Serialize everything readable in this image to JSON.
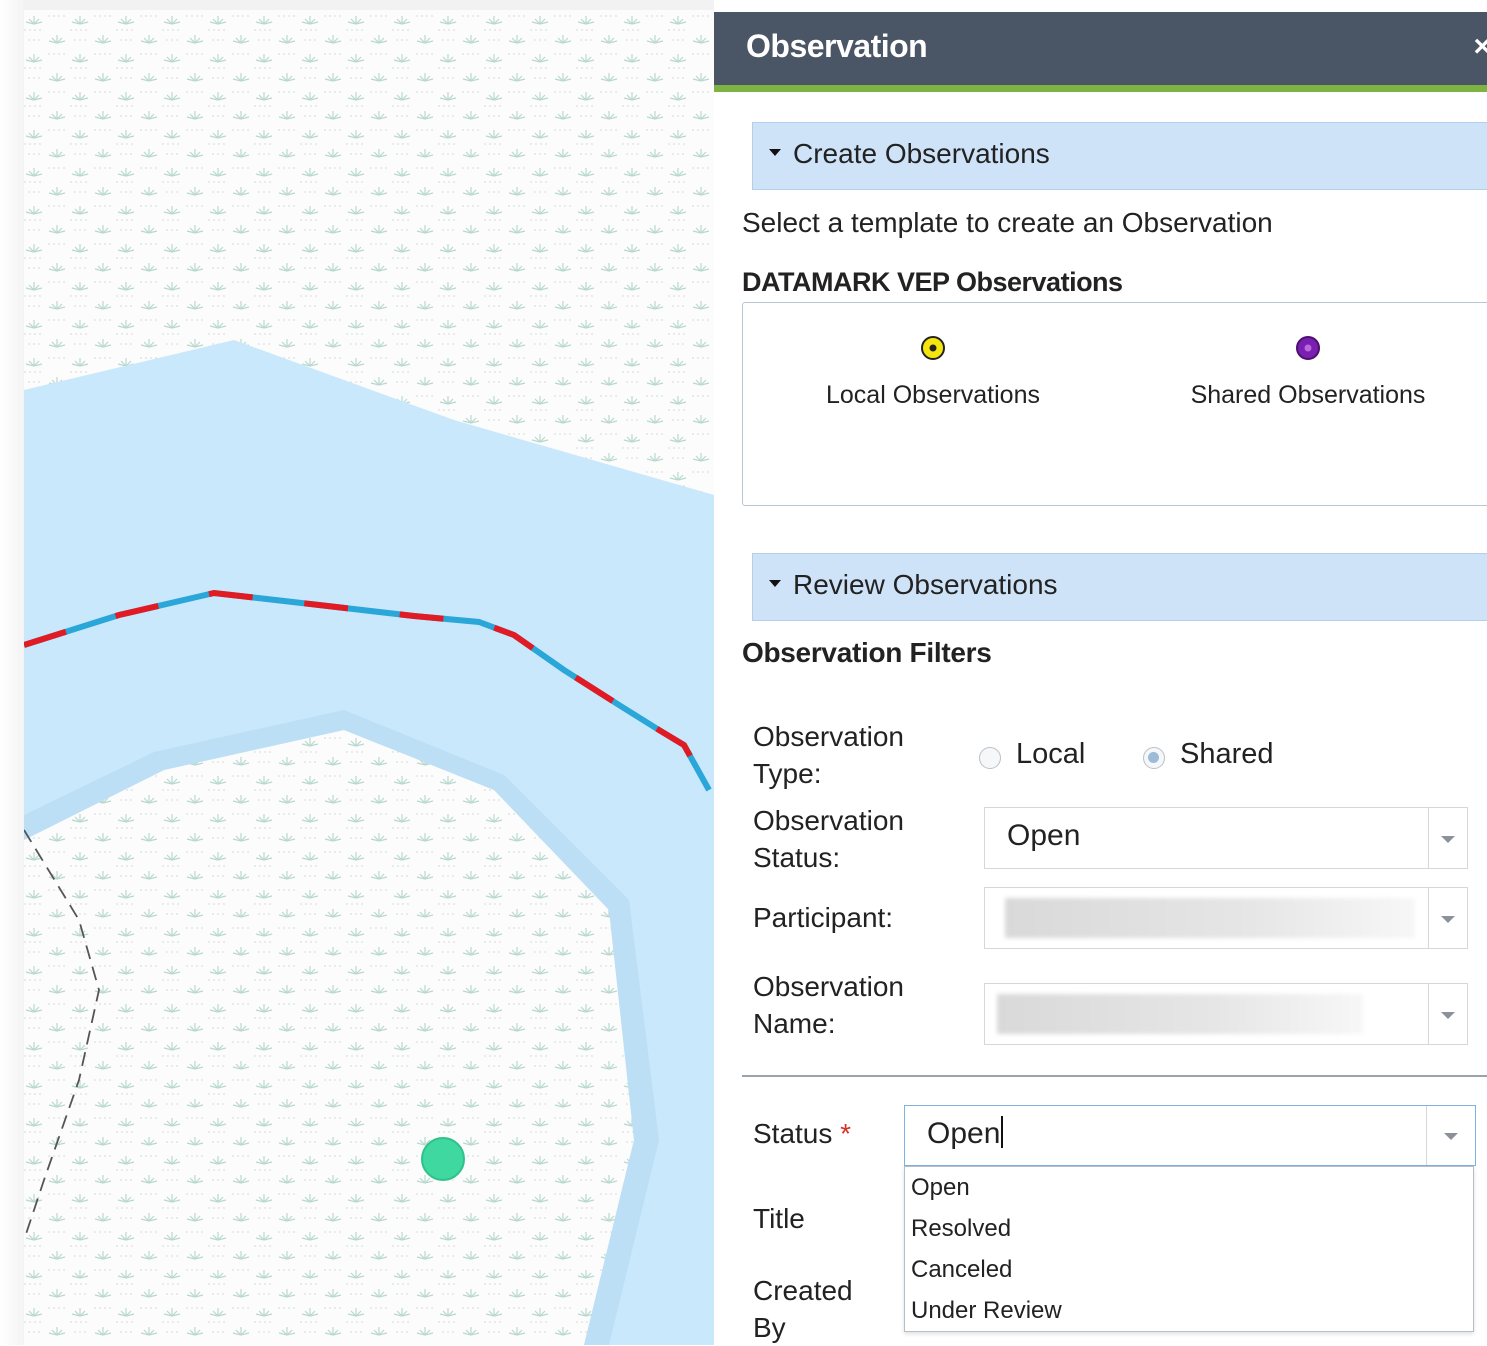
{
  "panel": {
    "title": "Observation",
    "close_icon": "close-icon"
  },
  "create_section": {
    "header": "Create Observations",
    "instruction": "Select a template to create an Observation",
    "group_title": "DATAMARK VEP Observations",
    "templates": [
      {
        "label": "Local Observations",
        "icon": "target-point-icon",
        "color": "#f5e50f"
      },
      {
        "label": "Shared Observations",
        "icon": "purple-point-icon",
        "color": "#7b1fb0"
      }
    ]
  },
  "review_section": {
    "header": "Review Observations",
    "filters_title": "Observation Filters",
    "type_label": "Observation Type:",
    "type_options": [
      "Local",
      "Shared"
    ],
    "type_selected": "Shared",
    "status_label": "Observation Status:",
    "status_value": "Open",
    "participant_label": "Participant:",
    "name_label": "Observation Name:"
  },
  "form": {
    "status_label": "Status",
    "required_mark": "*",
    "status_value": "Open",
    "status_options": [
      "Open",
      "Resolved",
      "Canceled",
      "Under Review"
    ],
    "title_label": "Title",
    "created_by_label": "Created By"
  },
  "map": {
    "colors": {
      "water": "#c9e8fb",
      "line_red": "#e01b24",
      "line_blue": "#2aa7d8",
      "marker": "#3fd8a0"
    }
  }
}
